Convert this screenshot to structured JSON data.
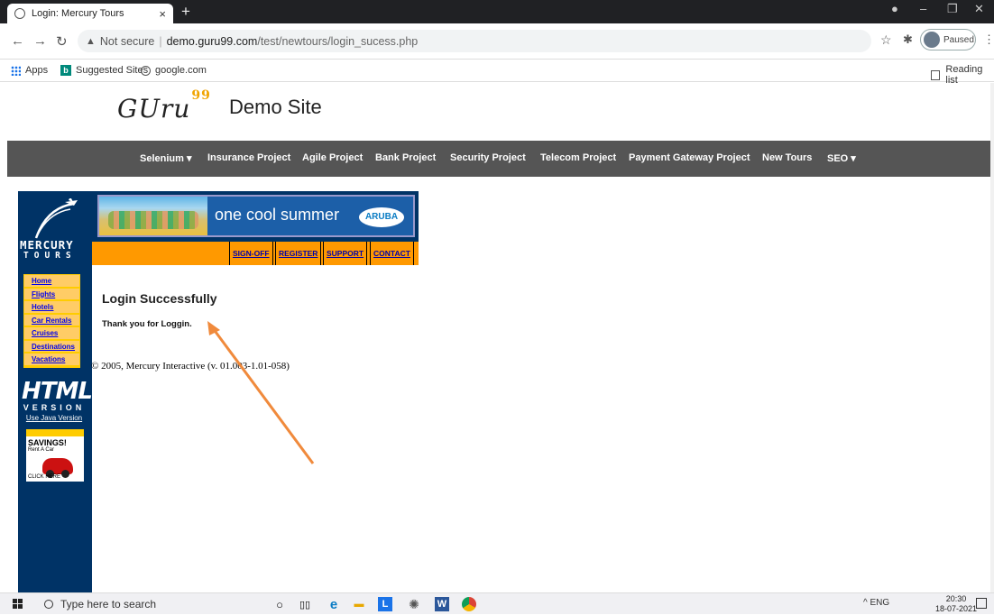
{
  "browser": {
    "tab_title": "Login: Mercury Tours",
    "tab_close": "×",
    "new_tab": "+",
    "address": {
      "security": "Not secure",
      "host": "demo.guru99.com",
      "path": "/test/newtours/login_sucess.php"
    },
    "profile_label": "Paused",
    "bookmarks": [
      {
        "label": "Apps",
        "icon": "apps-grid-icon"
      },
      {
        "label": "Suggested Sites",
        "icon": "bing-icon"
      },
      {
        "label": "google.com",
        "icon": "globe-icon"
      }
    ],
    "reading_list": "Reading list"
  },
  "site": {
    "logo_text": "GUru",
    "logo_sup": "99",
    "title": "Demo Site",
    "nav": [
      "Selenium ▾",
      "Insurance Project",
      "Agile Project",
      "Bank Project",
      "Security Project",
      "Telecom Project",
      "Payment Gateway Project",
      "New Tours",
      "SEO ▾"
    ]
  },
  "mercury": {
    "brand_top": "MERCURY",
    "brand_bottom": "TOURS",
    "banner_text": "one cool summer",
    "banner_badge": "ARUBA",
    "top_links": [
      "SIGN-OFF",
      "REGISTER",
      "SUPPORT",
      "CONTACT"
    ],
    "side_links": [
      "Home",
      "Flights",
      "Hotels",
      "Car Rentals",
      "Cruises",
      "Destinations",
      "Vacations"
    ],
    "html_big": "HTML",
    "html_version": "VERSION",
    "java_link": "Use Java Version",
    "savings_title": "SAVINGS!",
    "savings_sub": "Rent A Car",
    "savings_click": "CLICK HERE",
    "content_title": "Login Successfully",
    "content_message": "Thank you for Loggin.",
    "copyright": "© 2005, Mercury Interactive (v. 01.003-1.01-058)"
  },
  "taskbar": {
    "search_placeholder": "Type here to search",
    "tray_text": "^ ENG",
    "time": "20:30",
    "date": "18-07-2021"
  },
  "colors": {
    "annotation_arrow": "#f08a3c",
    "nav_bg": "#555555",
    "mercury_navy": "#003366",
    "mercury_orange": "#ff9900"
  }
}
